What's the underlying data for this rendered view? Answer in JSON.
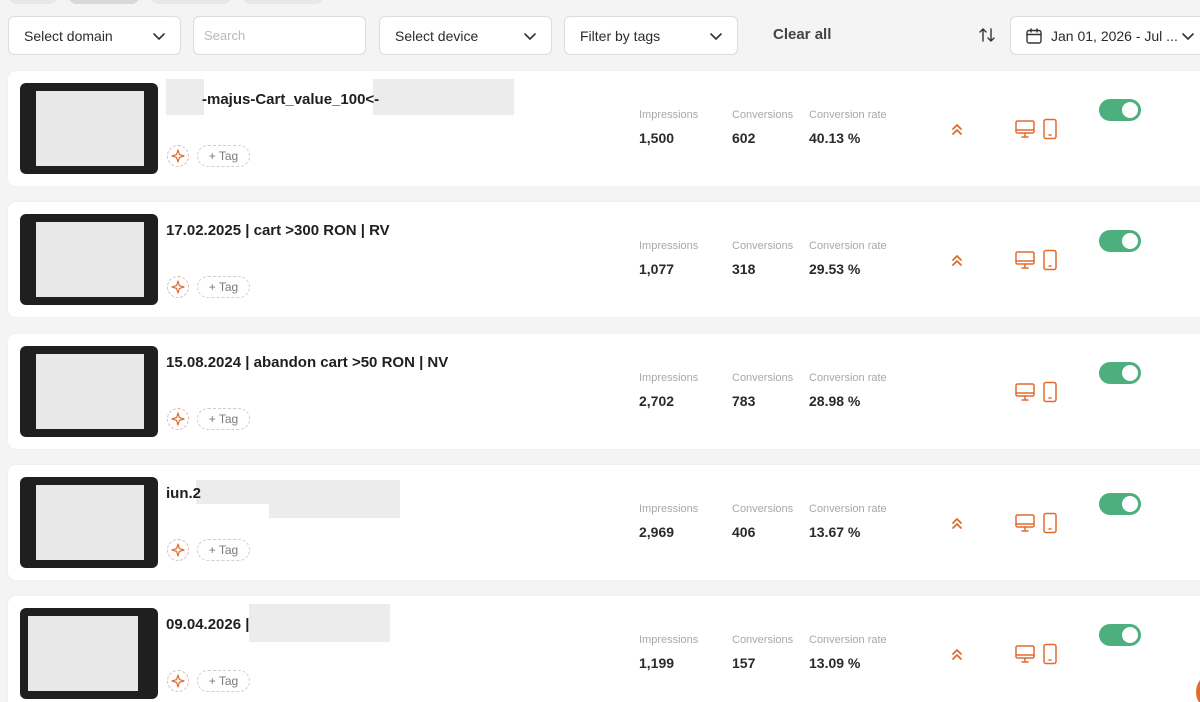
{
  "filters": {
    "domain_label": "Select domain",
    "search_placeholder": "Search",
    "device_label": "Select device",
    "tags_label": "Filter by tags",
    "clear_all": "Clear all",
    "date_range": "Jan 01, 2026 - Jul ..."
  },
  "metric_labels": {
    "impressions": "Impressions",
    "conversions": "Conversions",
    "conversion_rate": "Conversion rate"
  },
  "tag_button_label": "+ Tag",
  "colors": {
    "accent": "#e06b2e",
    "toggle_on": "#4caf7d"
  },
  "campaigns": [
    {
      "title": "-majus-Cart_value_100<-",
      "impressions": "1,500",
      "conversions": "602",
      "conversion_rate": "40.13 %",
      "enabled": true
    },
    {
      "title": "17.02.2025 | cart >300 RON | RV",
      "impressions": "1,077",
      "conversions": "318",
      "conversion_rate": "29.53 %",
      "enabled": true
    },
    {
      "title": "15.08.2024 | abandon cart >50 RON | NV",
      "impressions": "2,702",
      "conversions": "783",
      "conversion_rate": "28.98 %",
      "enabled": true
    },
    {
      "title": "iun.2",
      "impressions": "2,969",
      "conversions": "406",
      "conversion_rate": "13.67 %",
      "enabled": true
    },
    {
      "title": "09.04.2026 |",
      "impressions": "1,199",
      "conversions": "157",
      "conversion_rate": "13.09 %",
      "enabled": true
    }
  ]
}
